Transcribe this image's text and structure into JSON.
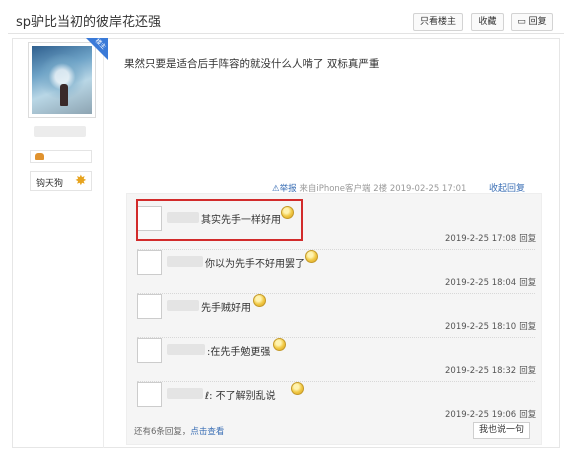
{
  "header": {
    "title": "sp驴比当初的彼岸花还强",
    "buttons": [
      "只看楼主",
      "收藏",
      "回复"
    ]
  },
  "author": {
    "badge": "楼主",
    "rank_label": "钩天狗"
  },
  "post": {
    "content": "果然只要是适合后手阵容的就没什么人啃了 双标真严重",
    "report": "⚠举报",
    "meta": "来自iPhone客户端  2楼  2019-02-25 17:01",
    "collapse": "收起回复"
  },
  "replies": [
    {
      "text": "其实先手一样好用",
      "time": "2019-2-25 17:08",
      "reply": "回复"
    },
    {
      "text": "你以为先手不好用罢了",
      "time": "2019-2-25 18:04",
      "reply": "回复"
    },
    {
      "text": "先手贼好用",
      "time": "2019-2-25 18:10",
      "reply": "回复"
    },
    {
      "text": ":在先手勉更强",
      "time": "2019-2-25 18:32",
      "reply": "回复"
    },
    {
      "text": "ℓ: 不了解别乱说",
      "time": "2019-2-25 19:06",
      "reply": "回复"
    }
  ],
  "footer": {
    "more_prefix": "还有6条回复，",
    "more_link": "点击查看",
    "say": "我也说一句"
  }
}
